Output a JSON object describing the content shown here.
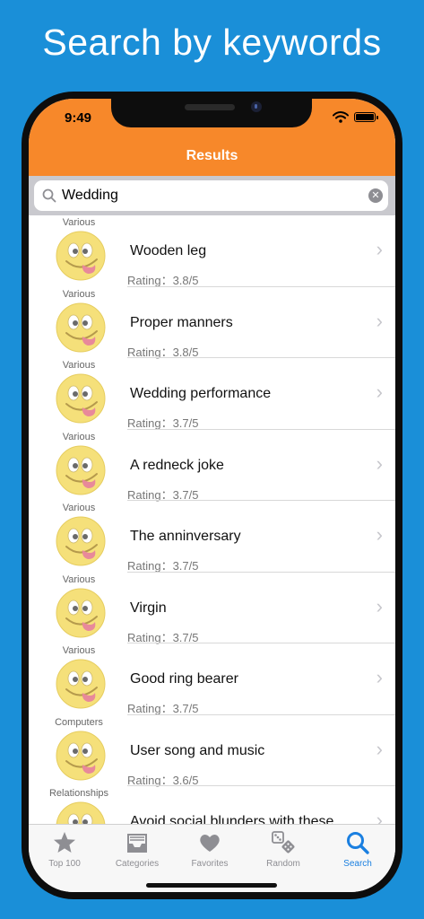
{
  "headline": "Search by keywords",
  "status": {
    "time": "9:49"
  },
  "nav": {
    "title": "Results"
  },
  "search": {
    "value": "Wedding",
    "clear": "✕"
  },
  "results": [
    {
      "category": "Various",
      "title": "Wooden leg",
      "rating": "Rating：3.8/5"
    },
    {
      "category": "Various",
      "title": "Proper manners",
      "rating": "Rating：3.8/5"
    },
    {
      "category": "Various",
      "title": "Wedding performance",
      "rating": "Rating：3.7/5"
    },
    {
      "category": "Various",
      "title": "A redneck joke",
      "rating": "Rating：3.7/5"
    },
    {
      "category": "Various",
      "title": "The anninversary",
      "rating": "Rating：3.7/5"
    },
    {
      "category": "Various",
      "title": "Virgin",
      "rating": "Rating：3.7/5"
    },
    {
      "category": "Various",
      "title": "Good ring bearer",
      "rating": "Rating：3.7/5"
    },
    {
      "category": "Computers",
      "title": "User song and music",
      "rating": "Rating：3.6/5"
    },
    {
      "category": "Relationships",
      "title": "Avoid social blunders with these",
      "rating": ""
    }
  ],
  "chevron": "›",
  "tabs": [
    {
      "label": "Top 100",
      "icon": "star-icon",
      "active": false
    },
    {
      "label": "Categories",
      "icon": "inbox-icon",
      "active": false
    },
    {
      "label": "Favorites",
      "icon": "heart-icon",
      "active": false
    },
    {
      "label": "Random",
      "icon": "dice-icon",
      "active": false
    },
    {
      "label": "Search",
      "icon": "search-icon",
      "active": true
    }
  ],
  "colors": {
    "background": "#1a8fd8",
    "nav_bar": "#f7882a",
    "tab_active": "#1a7fe0",
    "tab_inactive": "#8e8e93"
  }
}
